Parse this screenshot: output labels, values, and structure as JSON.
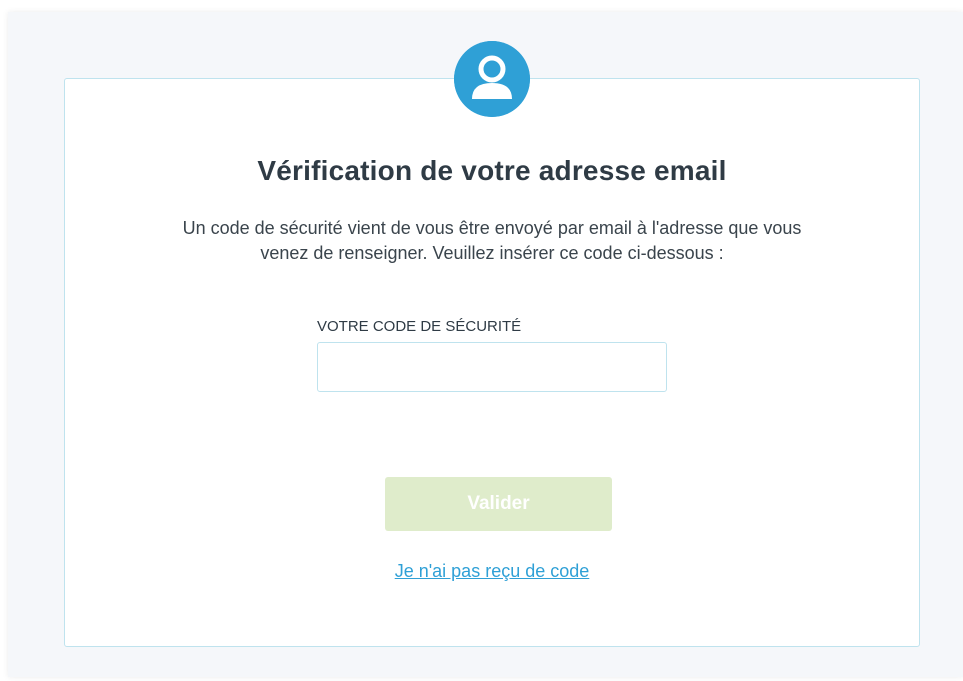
{
  "header": {
    "avatar_icon": "user-avatar-icon",
    "accent_color": "#2fa0d6"
  },
  "main": {
    "title": "Vérification de votre adresse email",
    "description": "Un code de sécurité vient de vous être envoyé par email à l'adresse que vous venez de renseigner. Veuillez insérer ce code ci-dessous :",
    "code_field": {
      "label": "VOTRE CODE DE SÉCURITÉ",
      "value": "",
      "placeholder": ""
    },
    "submit_label": "Valider",
    "submit_color": "#dfeccb",
    "resend_link": "Je n'ai pas reçu de code"
  }
}
